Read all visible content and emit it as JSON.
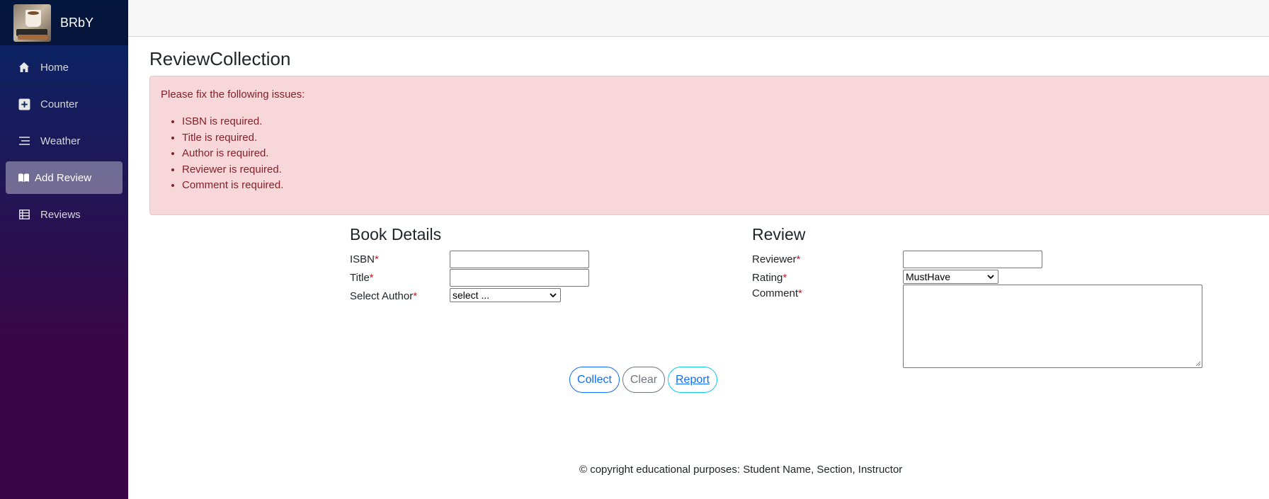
{
  "brand": {
    "name": "BRbY"
  },
  "nav": [
    {
      "label": "Home",
      "icon": "home-icon"
    },
    {
      "label": "Counter",
      "icon": "plus-square-icon"
    },
    {
      "label": "Weather",
      "icon": "list-icon"
    },
    {
      "label": "Add Review",
      "icon": "book-icon",
      "active": true
    },
    {
      "label": "Reviews",
      "icon": "table-icon"
    }
  ],
  "page": {
    "title": "ReviewCollection"
  },
  "validation": {
    "header": "Please fix the following issues:",
    "errors": [
      "ISBN is required.",
      "Title is required.",
      "Author is required.",
      "Reviewer is required.",
      "Comment is required."
    ]
  },
  "book_details": {
    "heading": "Book Details",
    "isbn_label": "ISBN",
    "title_label": "Title",
    "author_label": "Select Author",
    "author_selected": "select ...",
    "required_mark": "*"
  },
  "review": {
    "heading": "Review",
    "reviewer_label": "Reviewer",
    "rating_label": "Rating",
    "rating_selected": "MustHave",
    "comment_label": "Comment",
    "required_mark": "*"
  },
  "buttons": {
    "collect": "Collect",
    "clear": "Clear",
    "report": "Report"
  },
  "footer": {
    "text": "© copyright educational purposes: Student Name, Section, Instructor"
  },
  "colors": {
    "accent": "#0d6efd",
    "alert_bg": "#f8d7da",
    "alert_text": "#842029",
    "required": "#dd1111"
  }
}
